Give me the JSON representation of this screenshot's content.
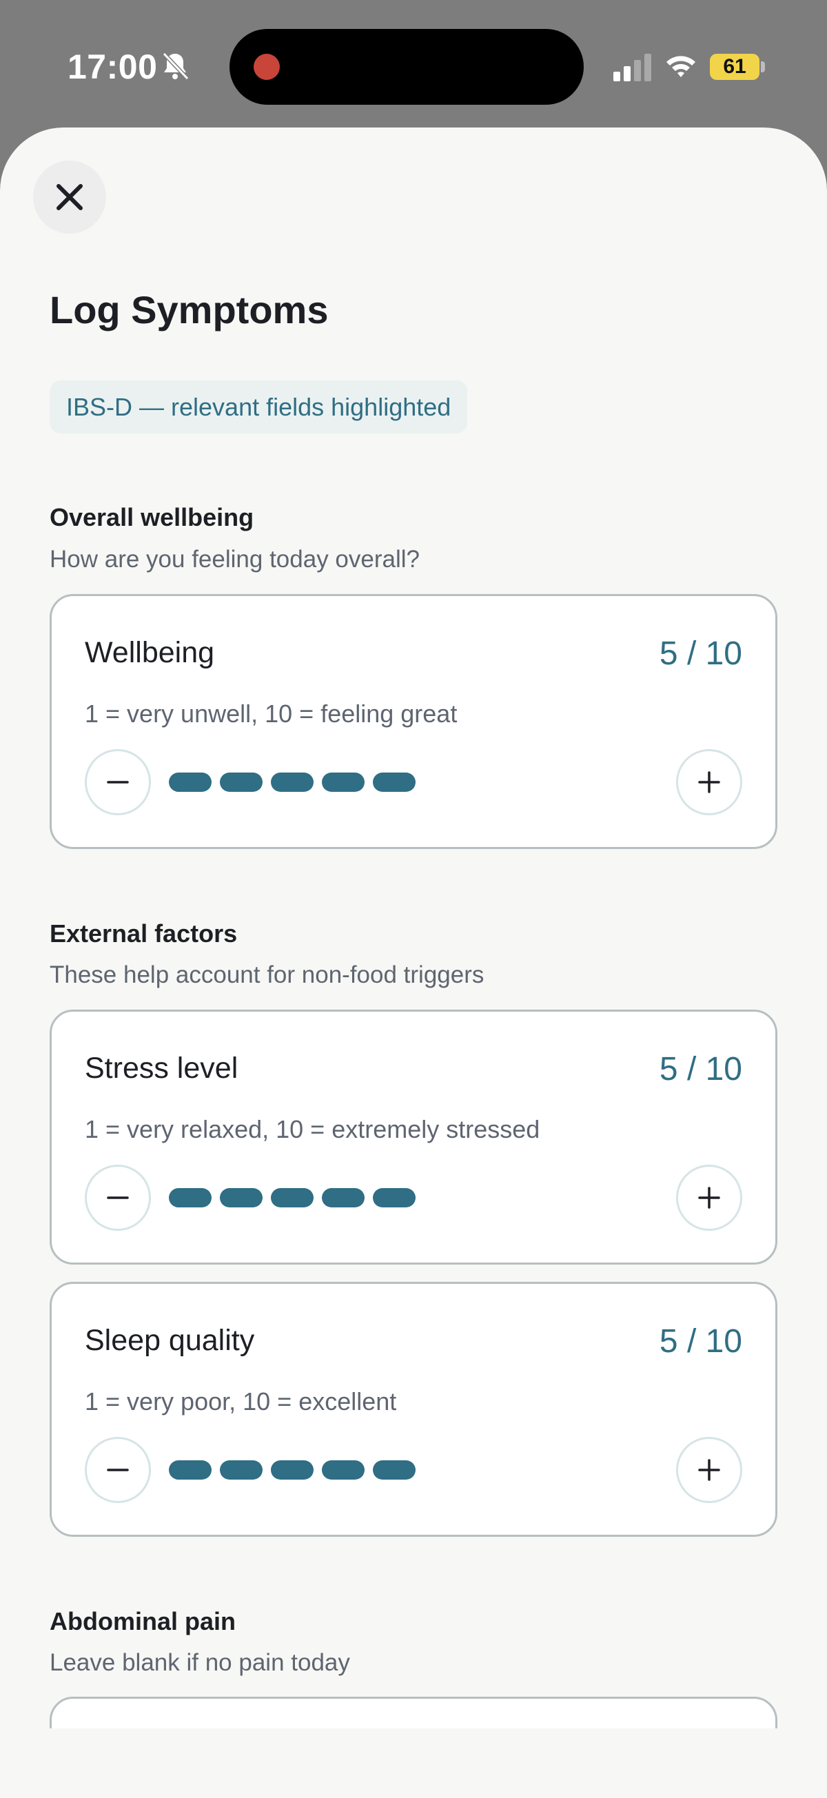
{
  "status": {
    "time": "17:00",
    "battery": "61",
    "colors": {
      "record": "#c9453a",
      "battery": "#f2d44a"
    },
    "icons": [
      "bell-slash-icon",
      "signal-icon",
      "wifi-icon",
      "battery-icon"
    ]
  },
  "header": {
    "close_icon": "close-icon",
    "title": "Log Symptoms",
    "badge": "IBS-D — relevant fields highlighted"
  },
  "sections": {
    "wellbeing": {
      "title": "Overall wellbeing",
      "subtitle": "How are you feeling today overall?",
      "card": {
        "label": "Wellbeing",
        "value": "5 / 10",
        "hint": "1 = very unwell, 10 = feeling great",
        "level": 5
      }
    },
    "external": {
      "title": "External factors",
      "subtitle": "These help account for non-food triggers",
      "stress": {
        "label": "Stress level",
        "value": "5 / 10",
        "hint": "1 = very relaxed, 10 = extremely stressed",
        "level": 5
      },
      "sleep": {
        "label": "Sleep quality",
        "value": "5 / 10",
        "hint": "1 = very poor, 10 = excellent",
        "level": 5
      }
    },
    "pain": {
      "title": "Abdominal pain",
      "subtitle": "Leave blank if no pain today"
    }
  },
  "theme": {
    "accent": "#2f6e84",
    "background": "#f7f7f5",
    "border": "#b6bfc1"
  }
}
